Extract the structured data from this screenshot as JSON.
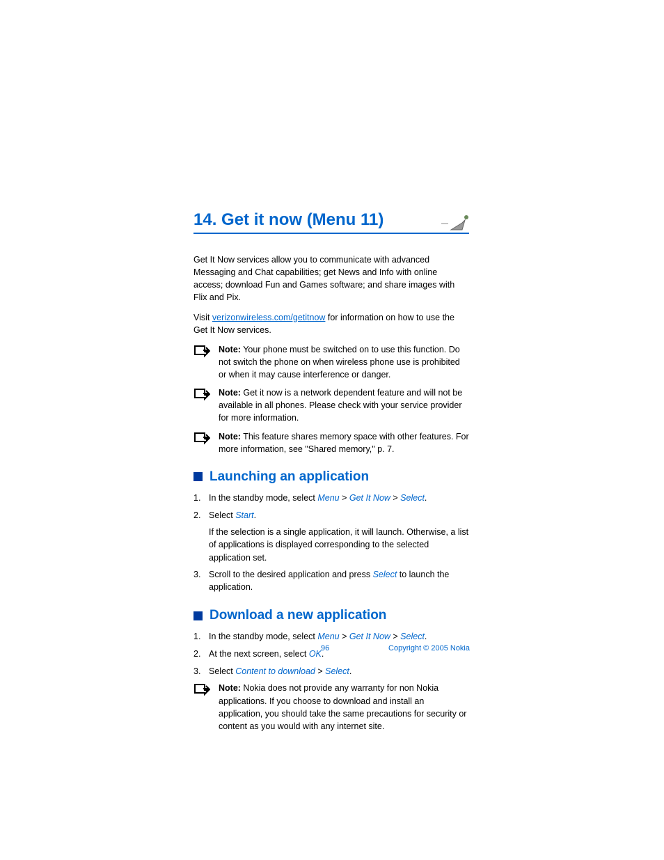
{
  "chapter": {
    "title": "14. Get it now (Menu 11)"
  },
  "intro": {
    "p1": "Get It Now services allow you to communicate with advanced Messaging and Chat capabilities; get News and Info with online access; download Fun and Games software; and share images with Flix and Pix.",
    "visit_prefix": "Visit ",
    "visit_link": "verizonwireless.com/getitnow",
    "visit_suffix": " for information on how to use the Get It Now services."
  },
  "notes": {
    "label": "Note:",
    "n1": " Your phone must be switched on to use this function. Do not switch the phone on when wireless phone use is prohibited or when it may cause interference or danger.",
    "n2": " Get it now is a network dependent feature and will not be available in all phones. Please check with your service provider for more information.",
    "n3": " This feature shares memory space with other features. For more information, see \"Shared memory,\" p. 7."
  },
  "section1": {
    "title": "Launching an application",
    "s1_prefix": "In the standby mode, select ",
    "s1_menu": "Menu",
    "s1_gt1": " > ",
    "s1_gin": "Get It Now",
    "s1_gt2": " > ",
    "s1_select": "Select",
    "s1_period": ".",
    "s2_prefix": "Select ",
    "s2_start": "Start",
    "s2_period": ".",
    "s2_sub": "If the selection is a single application, it will launch. Otherwise, a list of applications is displayed corresponding to the selected application set.",
    "s3_prefix": "Scroll to the desired application and press ",
    "s3_select": "Select",
    "s3_suffix": " to launch the application."
  },
  "section2": {
    "title": "Download a new application",
    "s1_prefix": "In the standby mode, select ",
    "s1_menu": "Menu",
    "s1_gt1": " > ",
    "s1_gin": "Get It Now",
    "s1_gt2": " > ",
    "s1_select": "Select",
    "s1_period": ".",
    "s2_prefix": "At the next screen, select ",
    "s2_ok": "OK",
    "s2_period": ".",
    "s3_prefix": "Select ",
    "s3_ctd": "Content to download",
    "s3_gt": " > ",
    "s3_select": "Select",
    "s3_period": ".",
    "note": " Nokia does not provide any warranty for non Nokia applications. If you choose to download and install an application, you should take the same precautions for security or content as you would with any internet site."
  },
  "footer": {
    "page": "96",
    "copyright": "Copyright © 2005 Nokia"
  }
}
